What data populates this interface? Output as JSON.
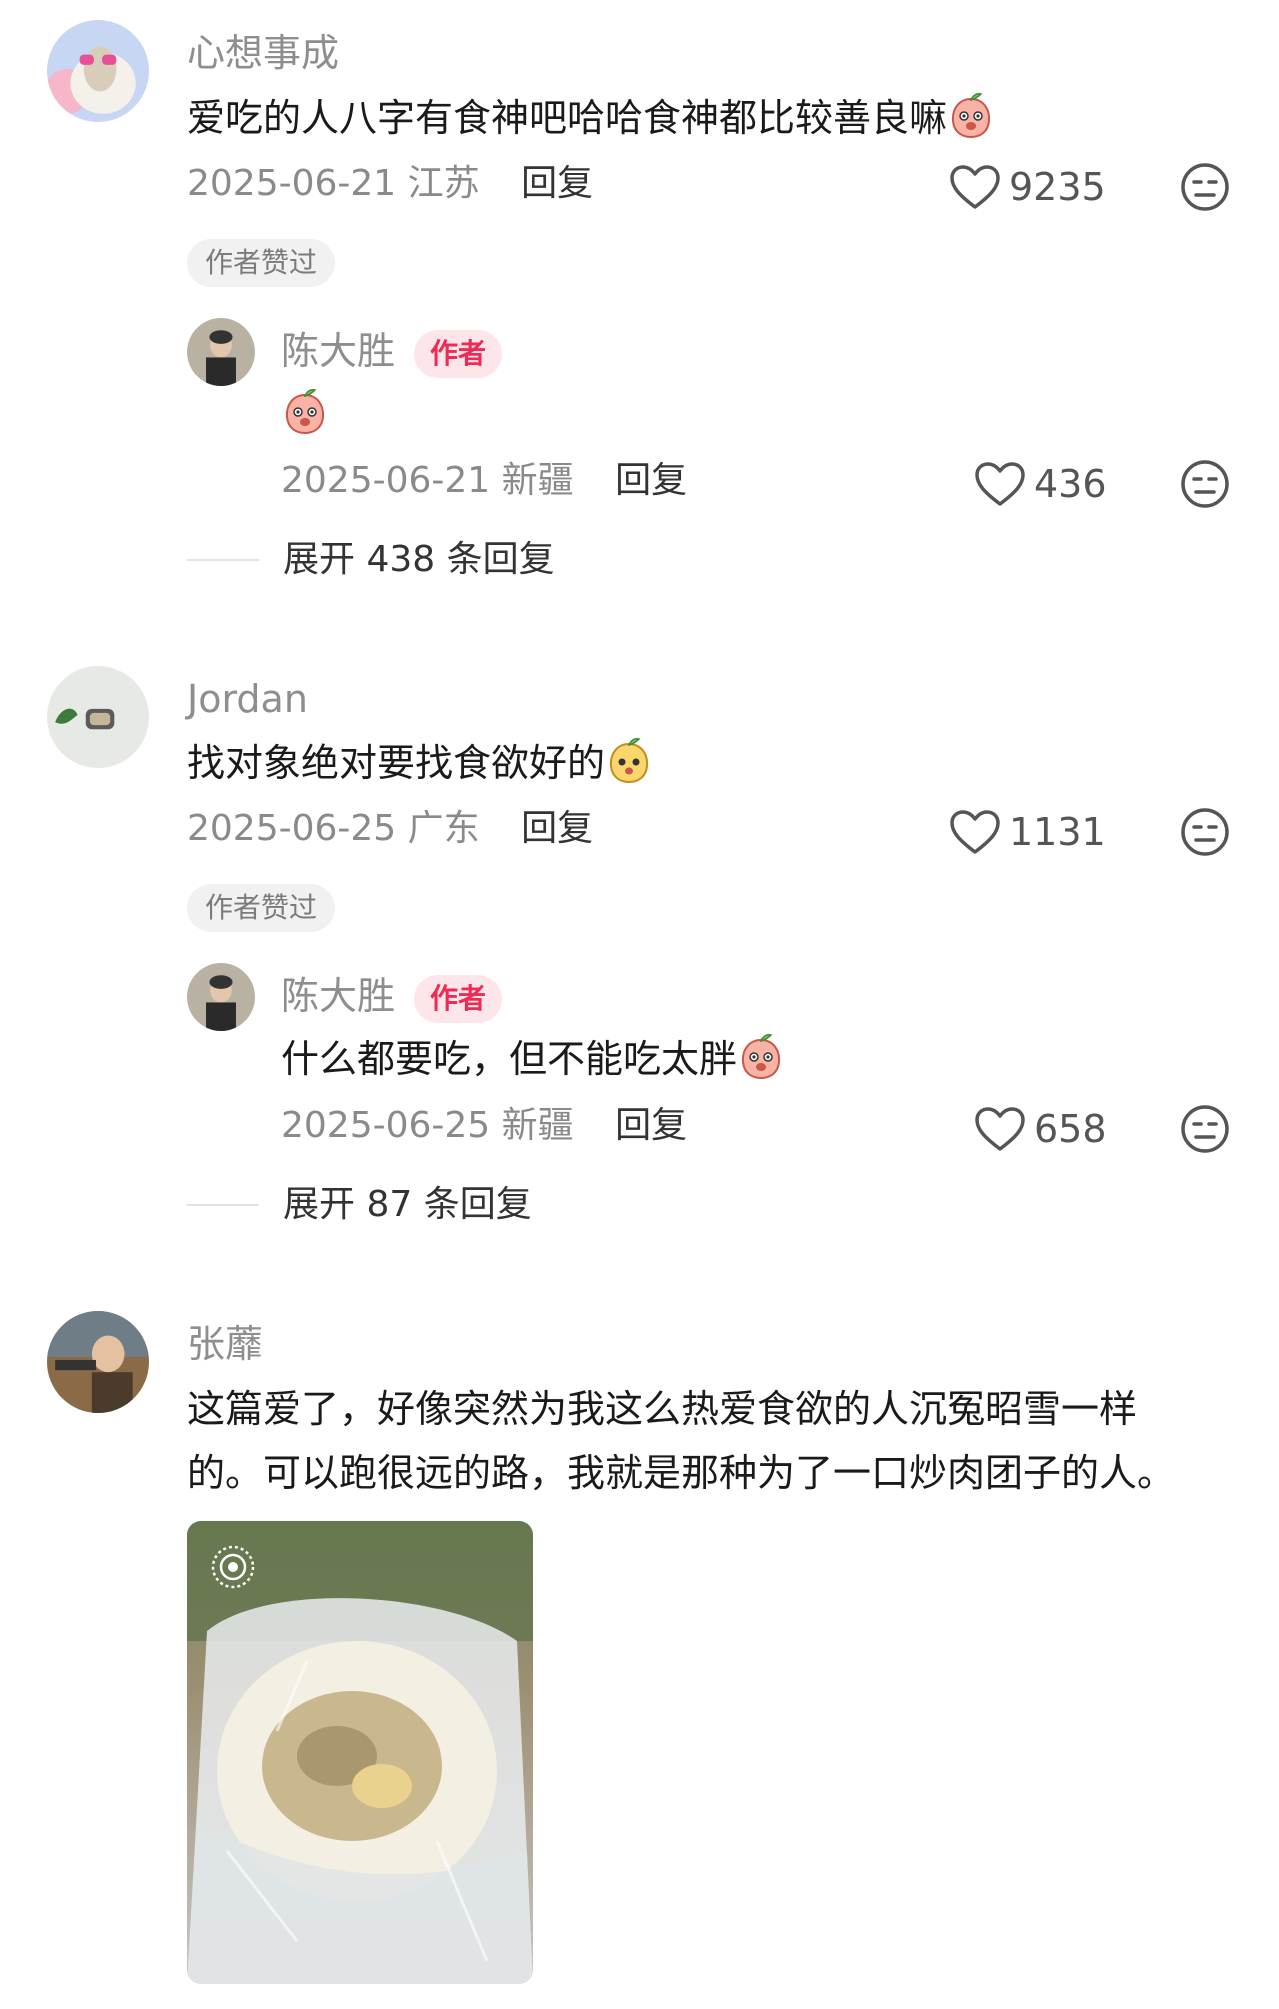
{
  "comments": [
    {
      "name": "心想事成",
      "text": "爱吃的人八字有食神吧哈哈食神都比较善良嘛",
      "date": "2025-06-21",
      "location": "江苏",
      "reply_label": "回复",
      "likes": "9235",
      "badge": "作者赞过",
      "author_reply": {
        "name": "陈大胜",
        "tag": "作者",
        "text": "",
        "date": "2025-06-21",
        "location": "新疆",
        "reply_label": "回复",
        "likes": "436"
      },
      "expand": "展开 438 条回复"
    },
    {
      "name": "Jordan",
      "text": "找对象绝对要找食欲好的",
      "date": "2025-06-25",
      "location": "广东",
      "reply_label": "回复",
      "likes": "1131",
      "badge": "作者赞过",
      "author_reply": {
        "name": "陈大胜",
        "tag": "作者",
        "text": "什么都要吃，但不能吃太胖",
        "date": "2025-06-25",
        "location": "新疆",
        "reply_label": "回复",
        "likes": "658"
      },
      "expand": "展开 87 条回复"
    },
    {
      "name": "张蘼",
      "text_line1": "这篇爱了，好像突然为我这么热爱食欲的人沉冤昭雪一样",
      "text_line2": "的。可以跑很远的路，我就是那种为了一口炒肉团子的人。"
    }
  ],
  "icons": {
    "like": "heart-outline-icon",
    "dislike": "neutral-face-icon",
    "emoji": "peach-sticker-icon",
    "live_photo": "live-photo-icon"
  },
  "colors": {
    "author_tag": "#ee2a55",
    "author_tag_bg": "#fde6ea",
    "meta": "#8a8a8a"
  }
}
